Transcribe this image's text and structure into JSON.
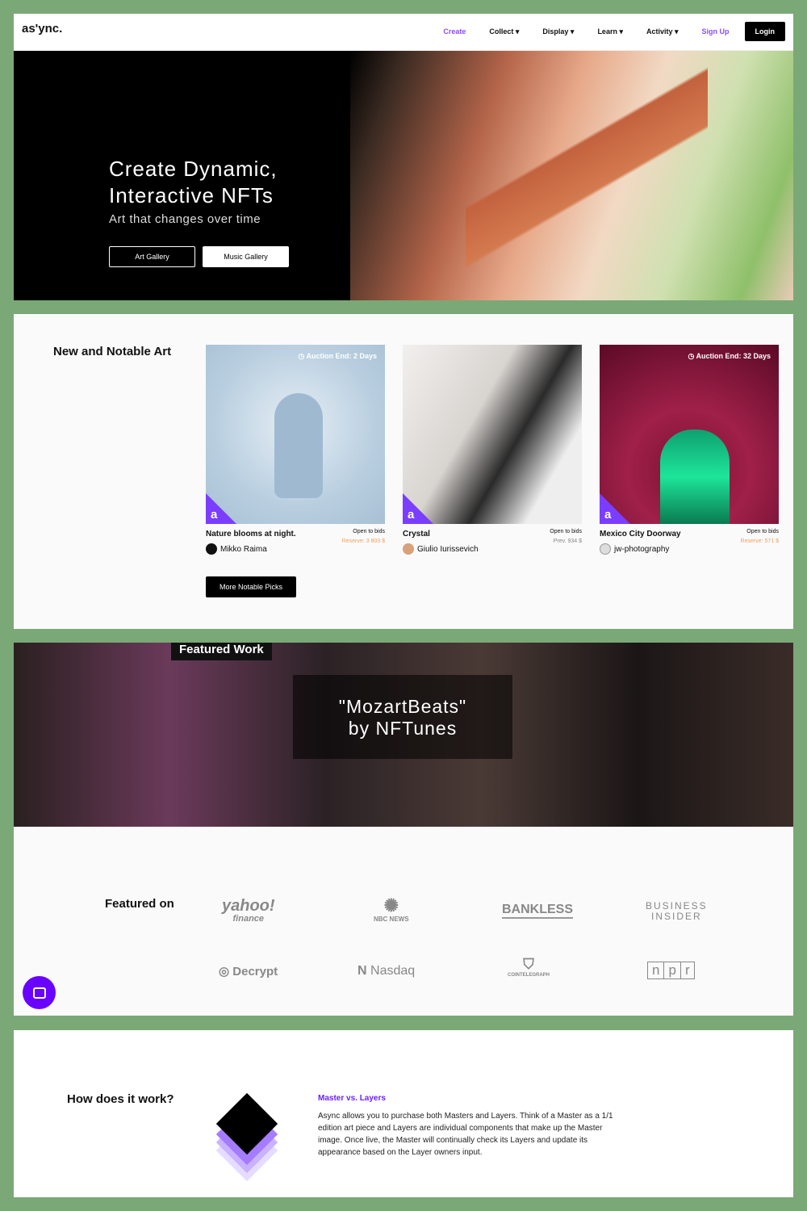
{
  "nav": {
    "logo": "as'ync.",
    "items": [
      "Create",
      "Collect ▾",
      "Display ▾",
      "Learn ▾",
      "Activity ▾"
    ],
    "signup": "Sign Up",
    "login": "Login",
    "accent": "#8a4dff"
  },
  "hero": {
    "title_line1": "Create Dynamic,",
    "title_line2": "Interactive NFTs",
    "subtitle": "Art that changes over time",
    "btn_art": "Art Gallery",
    "btn_music": "Music Gallery"
  },
  "notable": {
    "heading": "New and Notable Art",
    "badge": "a",
    "more": "More Notable Picks",
    "cards": [
      {
        "title": "Nature blooms at night.",
        "status": "Open to bids",
        "price": "Reserve: 3 803 $",
        "author": "Mikko Raima",
        "auction": "Auction End: 2 Days"
      },
      {
        "title": "Crystal",
        "status": "Open to bids",
        "price": "Prev. 934 $",
        "author": "Giulio Iurissevich",
        "auction": ""
      },
      {
        "title": "Mexico City Doorway",
        "status": "Open to bids",
        "price": "Reserve: 571 $",
        "author": "jw-photography",
        "auction": "Auction End: 32 Days"
      }
    ]
  },
  "featured": {
    "tag": "Featured Work",
    "title_line1": "\"MozartBeats\"",
    "title_line2": "by NFTunes"
  },
  "featured_on": {
    "heading": "Featured on",
    "logos": [
      "yahoo!",
      "finance",
      "NBC NEWS",
      "BANKLESS",
      "BUSINESS",
      "INSIDER",
      "Decrypt",
      "Nasdaq",
      "COINTELEGRAPH",
      "n",
      "p",
      "r"
    ]
  },
  "how": {
    "heading": "How does it work?",
    "title": "Master vs. Layers",
    "text": "Async allows you to purchase both Masters and Layers. Think of a Master as a 1/1 edition art piece and Layers are individual components that make up the Master image. Once live, the Master will continually check its Layers and update its appearance based on the Layer owners input."
  }
}
